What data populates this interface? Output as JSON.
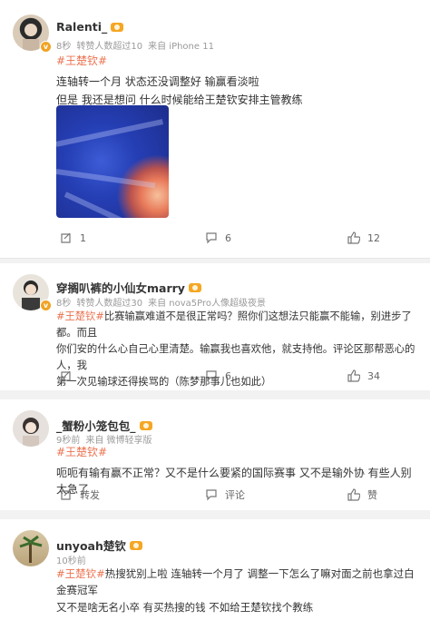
{
  "posts": [
    {
      "name": "Ralenti_",
      "meta": [
        "8秒",
        "转赞人数超过10",
        "来自 iPhone 11"
      ],
      "tag": "#王楚钦#",
      "lines": [
        "连轴转一个月 状态还没调整好 输赢看淡啦",
        "但是 我还是想问 什么时候能给王楚钦安排主管教练"
      ],
      "repost": "1",
      "comment": "6",
      "like": "12"
    },
    {
      "name": "穿搁叭裤的小仙女marry",
      "meta": [
        "8秒",
        "转赞人数超过30",
        "来自 nova5Pro人像超级夜景"
      ],
      "tag": "#王楚钦#",
      "lines": [
        "比赛输赢难道不是很正常吗？照你们这想法只能赢不能输，别进步了都。而且",
        "你们安的什么心自己心里清楚。输赢我也喜欢他，就支持他。评论区那帮恶心的人，我",
        "第一次见输球还得挨骂的（陈梦那事儿也如此）"
      ],
      "repost": "",
      "comment": "6",
      "like": "34"
    },
    {
      "name": "_蟹粉小笼包包_",
      "meta": [
        "9秒前",
        "来自 微博轻享版"
      ],
      "tag": "#王楚钦#",
      "lines": [
        "呃呃有输有赢不正常？又不是什么要紧的国际赛事 又不是输外协 有些人别太急了"
      ],
      "repost": "转发",
      "comment": "评论",
      "like": "赞"
    },
    {
      "name": "unyoah楚钦",
      "meta": [
        "10秒前"
      ],
      "tag": "#王楚钦#",
      "lines": [
        "热搜犹别上啦 连轴转一个月了 调整一下怎么了嘛对面之前也拿过白金赛冠军",
        "又不是啥无名小卒 有买热搜的钱 不如给王楚钦找个教练"
      ],
      "repost": "",
      "comment": "",
      "like": ""
    }
  ],
  "colors": {
    "tag": "#eb7350",
    "badge": "#f0a323",
    "bg": "#f2f2f2"
  },
  "icons": [
    "repost-icon",
    "comment-icon",
    "like-icon",
    "crown-icon"
  ]
}
